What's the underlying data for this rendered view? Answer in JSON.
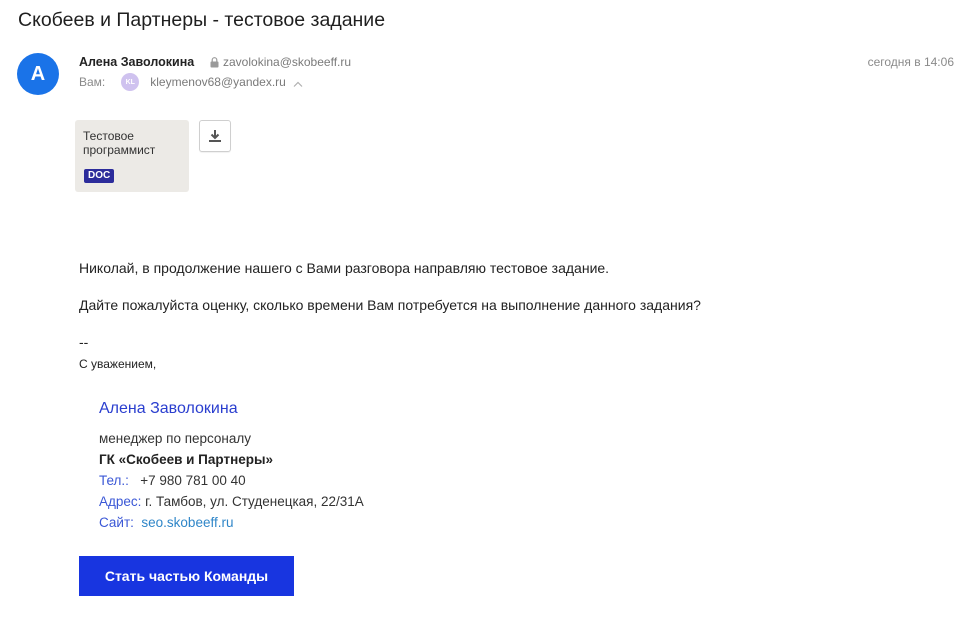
{
  "subject": "Скобеев и Партнеры - тестовое задание",
  "sender": {
    "avatar_letter": "A",
    "name": "Алена Заволокина",
    "email": "zavolokina@skobeeff.ru",
    "date": "сегодня в 14:06"
  },
  "recipient": {
    "label": "Вам:",
    "avatar_initials": "KL",
    "email": "kleymenov68@yandex.ru"
  },
  "attachment": {
    "name": "Тестовое программист",
    "type_badge": "DOC"
  },
  "body": {
    "line1": "Николай, в продолжение нашего с Вами разговора направляю тестовое задание.",
    "line2": "Дайте пожалуйста оценку, сколько времени Вам потребуется на выполнение данного задания?",
    "dashes": "--",
    "regards": "С уважением,"
  },
  "signature": {
    "name": "Алена Заволокина",
    "role": "менеджер по персоналу",
    "company": "ГК «Скобеев и Партнеры»",
    "phone_label": "Тел.:",
    "phone": "+7 980 781 00 40",
    "address_label": "Адрес:",
    "address": "г. Тамбов, ул. Студенецкая, 22/31А",
    "site_label": "Сайт:",
    "site": "seo.skobeeff.ru",
    "button_label": "Стать частью Команды"
  },
  "colors": {
    "avatar": "#1a73e8",
    "accent_blue": "#1835e0",
    "doc_badge": "#2c2c9b"
  },
  "icons": [
    "lock-icon",
    "chevron-up-icon",
    "download-icon"
  ]
}
